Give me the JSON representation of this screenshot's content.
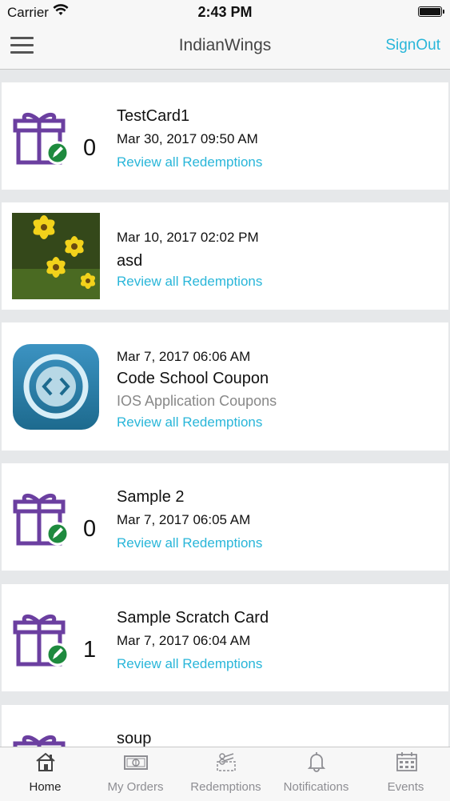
{
  "status_bar": {
    "carrier": "Carrier",
    "time": "2:43 PM"
  },
  "nav": {
    "title": "IndianWings",
    "signout_label": "SignOut"
  },
  "cards": [
    {
      "title": "TestCard1",
      "date": "Mar 30, 2017 09:50 AM",
      "count": "0",
      "link": "Review all Redemptions",
      "icon": "gift-icon"
    },
    {
      "date": "Mar 10, 2017 02:02 PM",
      "title": "asd",
      "link": "Review all Redemptions",
      "icon": "flower-photo"
    },
    {
      "date": "Mar 7, 2017 06:06 AM",
      "title": "Code School Coupon",
      "subtitle": "IOS Application Coupons",
      "link": "Review all Redemptions",
      "icon": "code-school-app-icon"
    },
    {
      "title": "Sample 2",
      "date": "Mar 7, 2017 06:05 AM",
      "count": "0",
      "link": "Review all Redemptions",
      "icon": "gift-icon"
    },
    {
      "title": "Sample Scratch Card",
      "date": "Mar 7, 2017 06:04 AM",
      "count": "1",
      "link": "Review all Redemptions",
      "icon": "gift-icon"
    },
    {
      "title": "soup",
      "icon": "gift-icon"
    }
  ],
  "tabs": [
    {
      "label": "Home",
      "icon": "home-icon",
      "active": true
    },
    {
      "label": "My Orders",
      "icon": "money-icon"
    },
    {
      "label": "Redemptions",
      "icon": "scissors-coupon-icon"
    },
    {
      "label": "Notifications",
      "icon": "bell-icon"
    },
    {
      "label": "Events",
      "icon": "calendar-icon"
    }
  ],
  "colors": {
    "accent": "#29b6d9",
    "gift_purple": "#6b3fa0",
    "edit_green": "#1e8a3e"
  }
}
